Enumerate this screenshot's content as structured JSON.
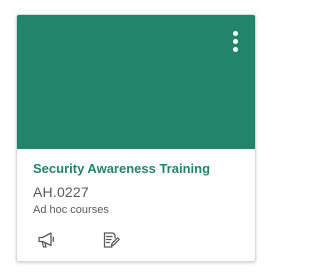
{
  "card": {
    "header_color": "#22846a",
    "title": "Security Awareness Training",
    "code": "AH.0227",
    "term": "Ad hoc courses",
    "menu_icon": "kebab-menu-icon",
    "actions": [
      {
        "icon": "announcements-icon"
      },
      {
        "icon": "assignments-icon"
      }
    ]
  }
}
